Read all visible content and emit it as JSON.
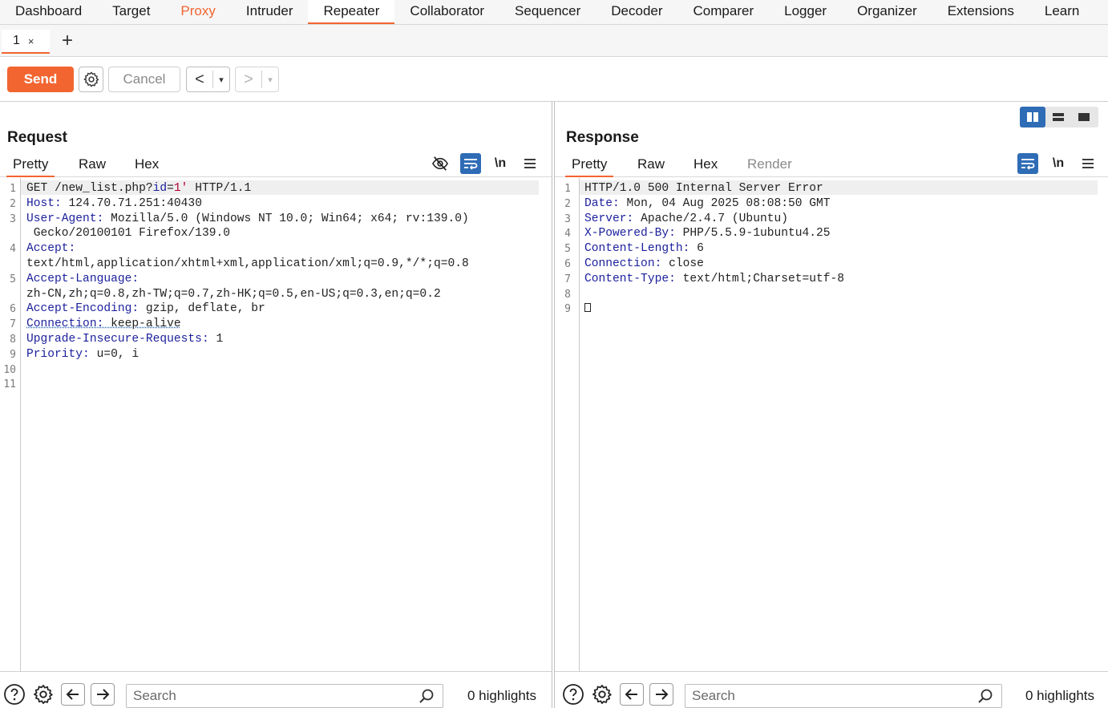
{
  "nav": {
    "items": [
      "Dashboard",
      "Target",
      "Proxy",
      "Intruder",
      "Repeater",
      "Collaborator",
      "Sequencer",
      "Decoder",
      "Comparer",
      "Logger",
      "Organizer",
      "Extensions",
      "Learn"
    ],
    "active": "Repeater",
    "highlight": "Proxy"
  },
  "subtab": {
    "label": "1",
    "close": "×",
    "add": "+"
  },
  "toolbar": {
    "send": "Send",
    "cancel": "Cancel",
    "back": "<",
    "forward": ">",
    "dropdown": "▾"
  },
  "request": {
    "title": "Request",
    "tabs": [
      "Pretty",
      "Raw",
      "Hex"
    ],
    "newline_tool": "\\n",
    "line_numbers": [
      "1",
      "2",
      "3",
      "",
      "4",
      "",
      "5",
      "",
      "6",
      "7",
      "8",
      "9",
      "10",
      "11"
    ],
    "lines": [
      {
        "head": "GET /new_list.php?",
        "key": "id",
        "mid": "=",
        "val": "1'",
        "tail": " HTTP/1.1"
      },
      {
        "key": "Host:",
        "val": " 124.70.71.251:40430"
      },
      {
        "key": "User-Agent:",
        "val": " Mozilla/5.0 (Windows NT 10.0; Win64; x64; rv:139.0)"
      },
      {
        "key": "",
        "val": " Gecko/20100101 Firefox/139.0"
      },
      {
        "key": "Accept:",
        "val": ""
      },
      {
        "key": "",
        "val": "text/html,application/xhtml+xml,application/xml;q=0.9,*/*;q=0.8"
      },
      {
        "key": "Accept-Language:",
        "val": ""
      },
      {
        "key": "",
        "val": "zh-CN,zh;q=0.8,zh-TW;q=0.7,zh-HK;q=0.5,en-US;q=0.3,en;q=0.2"
      },
      {
        "key": "Accept-Encoding:",
        "val": " gzip, deflate, br"
      },
      {
        "key": "Connection:",
        "val": " keep-alive"
      },
      {
        "key": "Upgrade-Insecure-Requests:",
        "val": " 1"
      },
      {
        "key": "Priority:",
        "val": " u=0, i"
      }
    ],
    "search_placeholder": "Search",
    "highlights": "0 highlights"
  },
  "response": {
    "title": "Response",
    "tabs": [
      "Pretty",
      "Raw",
      "Hex",
      "Render"
    ],
    "newline_tool": "\\n",
    "line_numbers": [
      "1",
      "2",
      "3",
      "4",
      "5",
      "6",
      "7",
      "8",
      "9"
    ],
    "lines": [
      {
        "key": "",
        "val": "HTTP/1.0 500 Internal Server Error"
      },
      {
        "key": "Date:",
        "val": " Mon, 04 Aug 2025 08:08:50 GMT"
      },
      {
        "key": "Server:",
        "val": " Apache/2.4.7 (Ubuntu)"
      },
      {
        "key": "X-Powered-By:",
        "val": " PHP/5.5.9-1ubuntu4.25"
      },
      {
        "key": "Content-Length:",
        "val": " 6"
      },
      {
        "key": "Connection:",
        "val": " close"
      },
      {
        "key": "Content-Type:",
        "val": " text/html;Charset=utf-8"
      }
    ],
    "search_placeholder": "Search",
    "highlights": "0 highlights"
  },
  "colors": {
    "accent": "#f26531",
    "blue": "#2f6cb6",
    "header_key": "#1b1f9c"
  }
}
